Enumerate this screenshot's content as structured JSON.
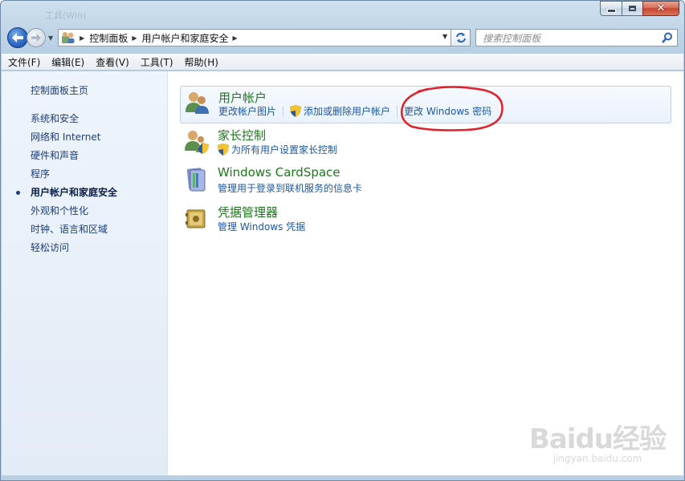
{
  "window": {
    "ghost_title": "工具(Win)",
    "caption": {
      "minimize": "–",
      "maximize": "□",
      "close": "✕"
    }
  },
  "nav": {
    "breadcrumb": [
      "控制面板",
      "用户帐户和家庭安全"
    ],
    "search_placeholder": "搜索控制面板"
  },
  "menu": [
    "文件(F)",
    "编辑(E)",
    "查看(V)",
    "工具(T)",
    "帮助(H)"
  ],
  "sidebar": {
    "home": "控制面板主页",
    "items": [
      {
        "label": "系统和安全",
        "active": false
      },
      {
        "label": "网络和 Internet",
        "active": false
      },
      {
        "label": "硬件和声音",
        "active": false
      },
      {
        "label": "程序",
        "active": false
      },
      {
        "label": "用户帐户和家庭安全",
        "active": true
      },
      {
        "label": "外观和个性化",
        "active": false
      },
      {
        "label": "时钟、语言和区域",
        "active": false
      },
      {
        "label": "轻松访问",
        "active": false
      }
    ]
  },
  "categories": [
    {
      "title": "用户帐户",
      "links": [
        "更改帐户图片",
        "添加或删除用户帐户",
        "更改 Windows 密码"
      ]
    },
    {
      "title": "家长控制",
      "links": [
        "为所有用户设置家长控制"
      ]
    },
    {
      "title": "Windows CardSpace",
      "links": [
        "管理用于登录到联机服务的信息卡"
      ]
    },
    {
      "title": "凭据管理器",
      "links": [
        "管理 Windows 凭据"
      ]
    }
  ],
  "watermark": {
    "logo": "Baidu经验",
    "url": "jingyan.baidu.com"
  },
  "colors": {
    "accent_link": "#1d57a8",
    "category_title": "#1a7a1a",
    "annotation": "#e0202a"
  }
}
